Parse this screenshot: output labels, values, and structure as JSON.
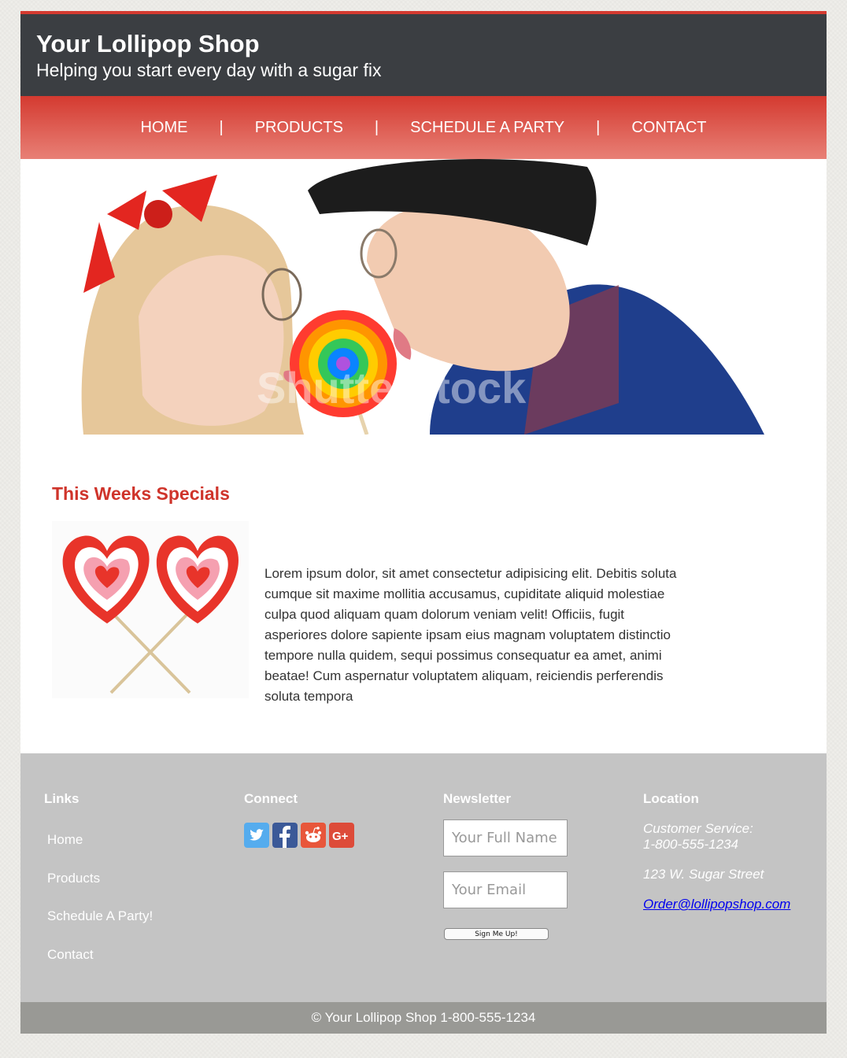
{
  "header": {
    "title": "Your Lollipop Shop",
    "tagline": "Helping you start every day with a sugar fix"
  },
  "nav": {
    "items": [
      {
        "label": "HOME"
      },
      {
        "label": "PRODUCTS"
      },
      {
        "label": "SCHEDULE A PARTY"
      },
      {
        "label": "CONTACT"
      }
    ],
    "separator": "|"
  },
  "hero": {
    "watermark": "Shutterstock"
  },
  "specials": {
    "title": "This Weeks Specials",
    "text": "Lorem ipsum dolor, sit amet consectetur adipisicing elit. Debitis soluta cumque sit maxime mollitia accusamus, cupiditate aliquid molestiae culpa quod aliquam quam dolorum veniam velit! Officiis, fugit asperiores dolore sapiente ipsam eius magnam voluptatem distinctio tempore nulla quidem, sequi possimus consequatur ea amet, animi beatae! Cum aspernatur voluptatem aliquam, reiciendis perferendis soluta tempora"
  },
  "footer": {
    "links": {
      "heading": "Links",
      "items": [
        {
          "label": "Home"
        },
        {
          "label": "Products"
        },
        {
          "label": "Schedule A Party!"
        },
        {
          "label": "Contact"
        }
      ]
    },
    "connect": {
      "heading": "Connect",
      "icons": [
        "twitter-icon",
        "facebook-icon",
        "reddit-icon",
        "google-plus-icon"
      ],
      "colors": {
        "twitter": "#55acee",
        "facebook": "#3b5998",
        "reddit": "#e8563a",
        "google_plus": "#dd4b39"
      }
    },
    "newsletter": {
      "heading": "Newsletter",
      "name_placeholder": "Your Full Name",
      "email_placeholder": "Your Email",
      "button_label": "Sign Me Up!"
    },
    "location": {
      "heading": "Location",
      "service_label": "Customer Service:",
      "phone": "1-800-555-1234",
      "address": "123 W. Sugar Street",
      "email": "Order@lollipopshop.com"
    }
  },
  "bottom_bar": {
    "text": "© Your Lollipop Shop 1-800-555-1234"
  },
  "colors": {
    "accent": "#d43a30",
    "header_bg": "#3b3e42",
    "footer_bg": "#c4c4c4",
    "bottom_bg": "#999995"
  }
}
